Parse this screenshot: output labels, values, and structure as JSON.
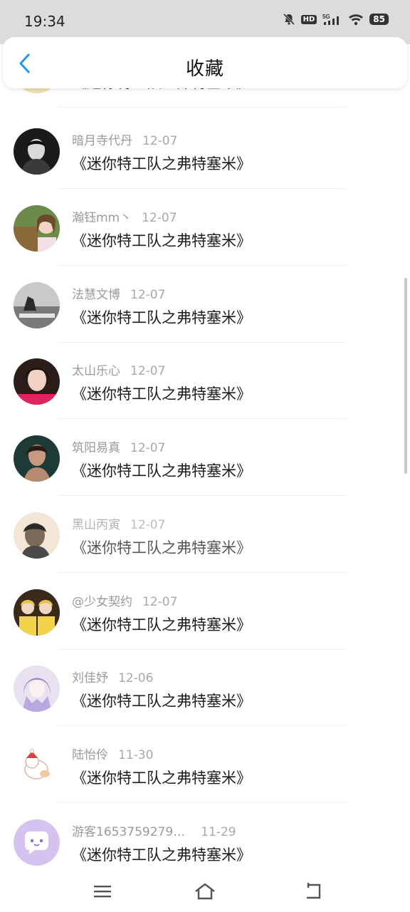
{
  "status": {
    "time": "19:34",
    "icons": [
      "mute-bell-icon",
      "hd-icon",
      "5g-signal-icon",
      "wifi-icon",
      "battery-icon"
    ],
    "hd": "HD",
    "network": "5G",
    "battery": "85"
  },
  "header": {
    "title": "收藏",
    "back_icon": "chevron-left-icon",
    "accent": "#2196f3"
  },
  "items": [
    {
      "user": "",
      "date": "",
      "title": "《迷你特工队之弗特塞米》"
    },
    {
      "user": "暗月寺代丹",
      "date": "12-07",
      "title": "《迷你特工队之弗特塞米》"
    },
    {
      "user": "瀚钰mm丶",
      "date": "12-07",
      "title": "《迷你特工队之弗特塞米》"
    },
    {
      "user": "法慧文博",
      "date": "12-07",
      "title": "《迷你特工队之弗特塞米》"
    },
    {
      "user": "太山乐心",
      "date": "12-07",
      "title": "《迷你特工队之弗特塞米》"
    },
    {
      "user": "筑阳易真",
      "date": "12-07",
      "title": "《迷你特工队之弗特塞米》"
    },
    {
      "user": "黑山丙寅",
      "date": "12-07",
      "title": "《迷你特工队之弗特塞米》"
    },
    {
      "user": "@少女契约",
      "date": "12-07",
      "title": "《迷你特工队之弗特塞米》"
    },
    {
      "user": "刘佳妤",
      "date": "12-06",
      "title": "《迷你特工队之弗特塞米》"
    },
    {
      "user": "陆怡伶",
      "date": "11-30",
      "title": "《迷你特工队之弗特塞米》"
    },
    {
      "user": "游客1653759279…",
      "date": "11-29",
      "title": "《迷你特工队之弗特塞米》"
    }
  ],
  "nav": {
    "menu_icon": "menu-icon",
    "home_icon": "home-icon",
    "back_icon": "return-icon"
  }
}
